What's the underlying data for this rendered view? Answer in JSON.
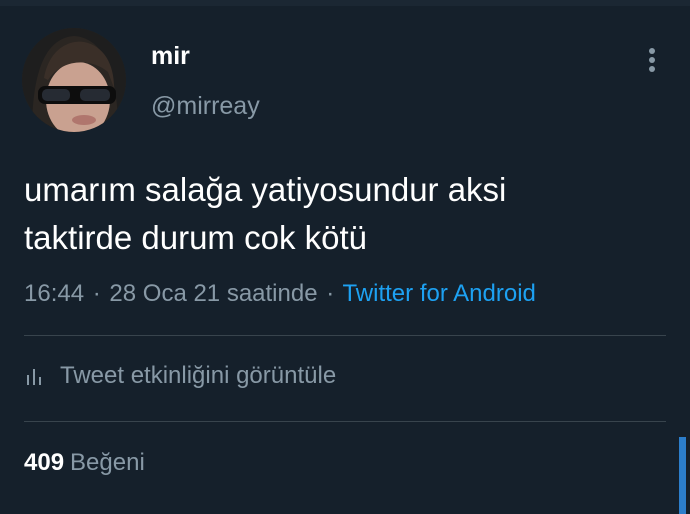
{
  "tweet": {
    "author_name": "mir",
    "author_handle": "@mirreay",
    "text_line1": "umarım salağa yatiyosundur aksi",
    "text_line2": "taktirde durum cok kötü",
    "time": "16:44",
    "separator": "·",
    "date_text": "28 Oca 21 saatinde",
    "source": "Twitter for Android"
  },
  "actions": {
    "activity_label": "Tweet etkinliğini görüntüle",
    "activity_icon": "analytics-bars-icon",
    "more_icon": "more-vertical-icon"
  },
  "stats": {
    "likes_count": "409",
    "likes_label": "Beğeni"
  },
  "colors": {
    "background": "#15202b",
    "secondary_text": "#8899a6",
    "link": "#1da1f2",
    "divider": "#38444d"
  }
}
